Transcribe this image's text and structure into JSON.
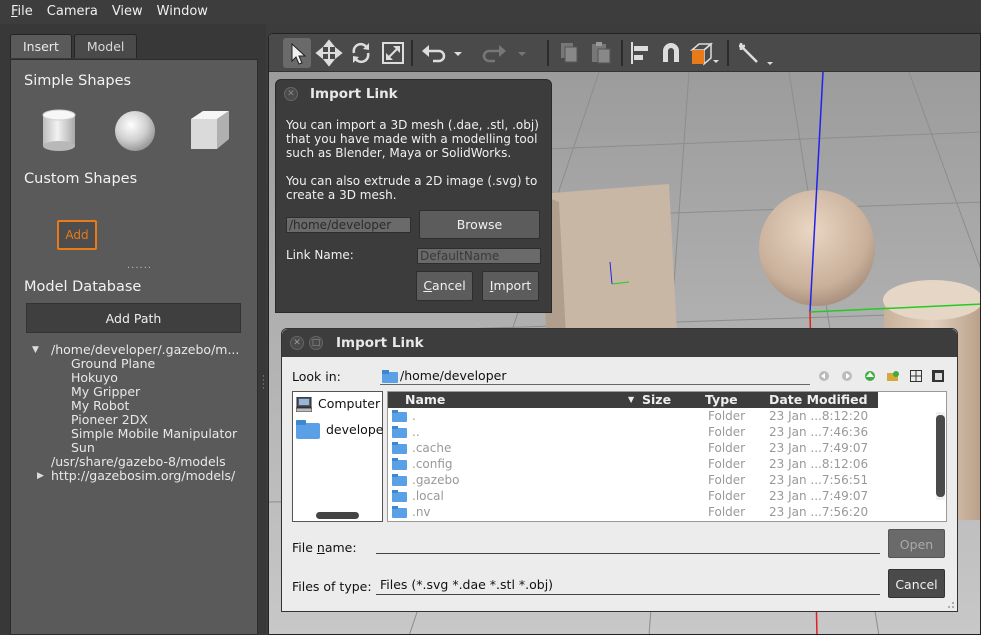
{
  "menubar": [
    {
      "first": "F",
      "rest": "ile",
      "underline": true
    },
    {
      "first": "",
      "rest": "Camera",
      "underline": false
    },
    {
      "first": "",
      "rest": "View",
      "underline": false
    },
    {
      "first": "",
      "rest": "Window",
      "underline": false
    }
  ],
  "left": {
    "tabs": [
      "Insert",
      "Model"
    ],
    "simple_shapes_title": "Simple Shapes",
    "custom_shapes_title": "Custom Shapes",
    "add_label": "Add",
    "dots": "......",
    "model_database_title": "Model Database",
    "add_path_label": "Add Path",
    "tree": [
      {
        "text": "/home/developer/.gazebo/m...",
        "indent": 0,
        "arrow": "down"
      },
      {
        "text": "Ground Plane",
        "indent": 1
      },
      {
        "text": "Hokuyo",
        "indent": 1
      },
      {
        "text": "My Gripper",
        "indent": 1
      },
      {
        "text": "My Robot",
        "indent": 1
      },
      {
        "text": "Pioneer 2DX",
        "indent": 1
      },
      {
        "text": "Simple Mobile Manipulator",
        "indent": 1
      },
      {
        "text": "Sun",
        "indent": 1
      },
      {
        "text": "/usr/share/gazebo-8/models",
        "indent": 0
      },
      {
        "text": "http://gazebosim.org/models/",
        "indent": 0,
        "arrow": "right"
      }
    ]
  },
  "dialog1": {
    "title": "Import Link",
    "p1": "You can import a 3D mesh (.dae, .stl, .obj) that you have made with a modelling tool such as Blender, Maya or SolidWorks.",
    "p2": "You can also extrude a 2D image (.svg) to create a 3D mesh.",
    "path_value": "/home/developer",
    "browse_label": "Browse",
    "link_name_label": "Link Name:",
    "link_name_placeholder": "DefaultName",
    "cancel_first": "C",
    "cancel_rest": "ancel",
    "import_first": "I",
    "import_rest": "mport"
  },
  "dialog2": {
    "title": "Import Link",
    "look_in_label": "Look in:",
    "look_in_value": "/home/developer",
    "places": [
      "Computer",
      "develope"
    ],
    "columns": [
      "Name",
      "Size",
      "Type",
      "Date Modified"
    ],
    "rows": [
      {
        "name": ".",
        "type": "Folder",
        "date": "23 Jan ...8:12:20"
      },
      {
        "name": "..",
        "type": "Folder",
        "date": "23 Jan ...7:46:36"
      },
      {
        "name": ".cache",
        "type": "Folder",
        "date": "23 Jan ...7:49:07"
      },
      {
        "name": ".config",
        "type": "Folder",
        "date": "23 Jan ...8:12:06"
      },
      {
        "name": ".gazebo",
        "type": "Folder",
        "date": "23 Jan ...7:56:51"
      },
      {
        "name": ".local",
        "type": "Folder",
        "date": "23 Jan ...7:49:07"
      },
      {
        "name": ".nv",
        "type": "Folder",
        "date": "23 Jan ...7:56:20"
      }
    ],
    "file_name_label": "File name:",
    "file_name_first": "n",
    "file_name_value": "",
    "files_of_type_label": "Files of type:",
    "files_of_type_value": "Files (*.svg *.dae *.stl *.obj)",
    "open_label": "Open",
    "cancel_label": "Cancel"
  },
  "icons": {
    "toolbar": [
      "select-arrow-icon",
      "translate-icon",
      "rotate-icon",
      "scale-icon",
      "undo-icon",
      "redo-icon",
      "copy-icon",
      "paste-icon",
      "align-icon",
      "snap-magnet-icon",
      "view-angle-cube-icon",
      "joint-link-icon"
    ],
    "accent": "#e87a1a"
  }
}
